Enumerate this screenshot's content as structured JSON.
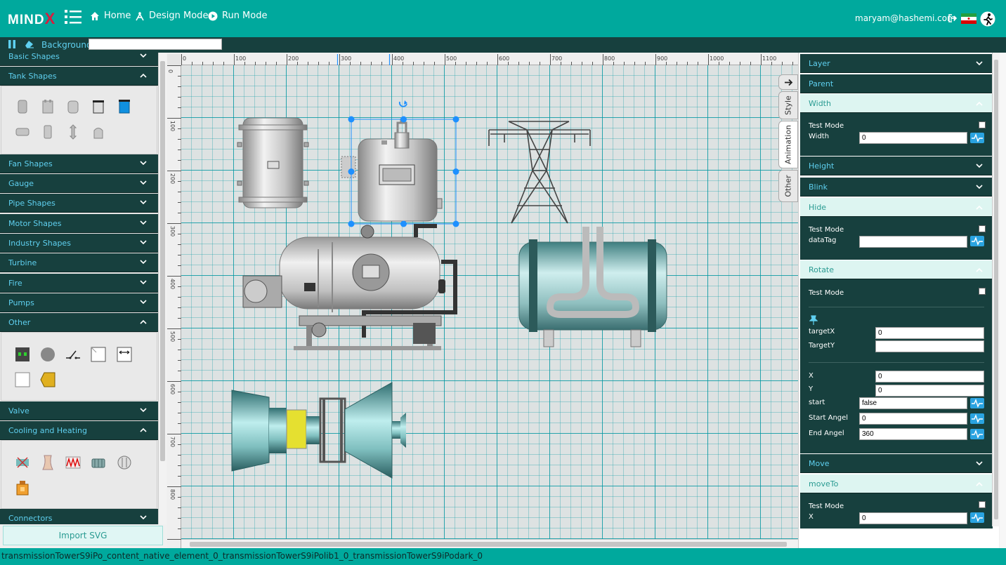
{
  "topbar": {
    "logo_text": "MIND",
    "logo_x": "X",
    "nav": {
      "home": "Home",
      "design": "Design Mode",
      "run": "Run Mode"
    },
    "user_email": "maryam@hashemi.com"
  },
  "toolbar": {
    "background_label": "Background",
    "background_value": ""
  },
  "left_panel": {
    "categories": {
      "basic": "Basic Shapes",
      "tank": "Tank Shapes",
      "fan": "Fan Shapes",
      "gauge": "Gauge",
      "pipe": "Pipe Shapes",
      "motor": "Motor Shapes",
      "industry": "Industry Shapes",
      "turbine": "Turbine",
      "fire": "Fire",
      "pumps": "Pumps",
      "other": "Other",
      "valve": "Valve",
      "cooling": "Cooling and Heating",
      "connectors": "Connectors"
    },
    "import_label": "Import SVG"
  },
  "ruler": {
    "top": [
      "0",
      "100",
      "200",
      "300",
      "400",
      "500",
      "600",
      "700",
      "800",
      "900",
      "1000",
      "1100"
    ],
    "left": [
      "0",
      "100",
      "200",
      "300",
      "400",
      "500",
      "600",
      "700",
      "800"
    ]
  },
  "side_tabs": {
    "style": "Style",
    "animation": "Animation",
    "other": "Other"
  },
  "right_panel": {
    "layer": "Layer",
    "parent": "Parent",
    "width": {
      "title": "Width",
      "test_mode": "Test Mode",
      "width_label": "Width",
      "width_value": "0"
    },
    "height": "Height",
    "blink": "Blink",
    "hide": {
      "title": "Hide",
      "test_mode": "Test Mode",
      "datatag_label": "dataTag",
      "datatag_value": ""
    },
    "rotate": {
      "title": "Rotate",
      "test_mode": "Test Mode",
      "targetx_label": "targetX",
      "targetx_value": "0",
      "targety_label": "TargetY",
      "targety_value": "",
      "x_label": "X",
      "x_value": "0",
      "y_label": "Y",
      "y_value": "0",
      "start_label": "start",
      "start_value": "false",
      "start_angel_label": "Start Angel",
      "start_angel_value": "0",
      "end_angel_label": "End Angel",
      "end_angel_value": "360"
    },
    "move": "Move",
    "moveto": {
      "title": "moveTo",
      "test_mode": "Test Mode",
      "x_label": "X",
      "x_value": "0"
    }
  },
  "statusbar": {
    "text": "transmissionTowerS9iPo_content_native_element_0_transmissionTowerS9iPolib1_0_transmissionTowerS9iPodark_0"
  },
  "colors": {
    "brand": "#00a99d",
    "panel": "#17403e",
    "accent": "#5fd0f0",
    "open_header": "#ddf5f1",
    "selection": "#1e90ff"
  }
}
